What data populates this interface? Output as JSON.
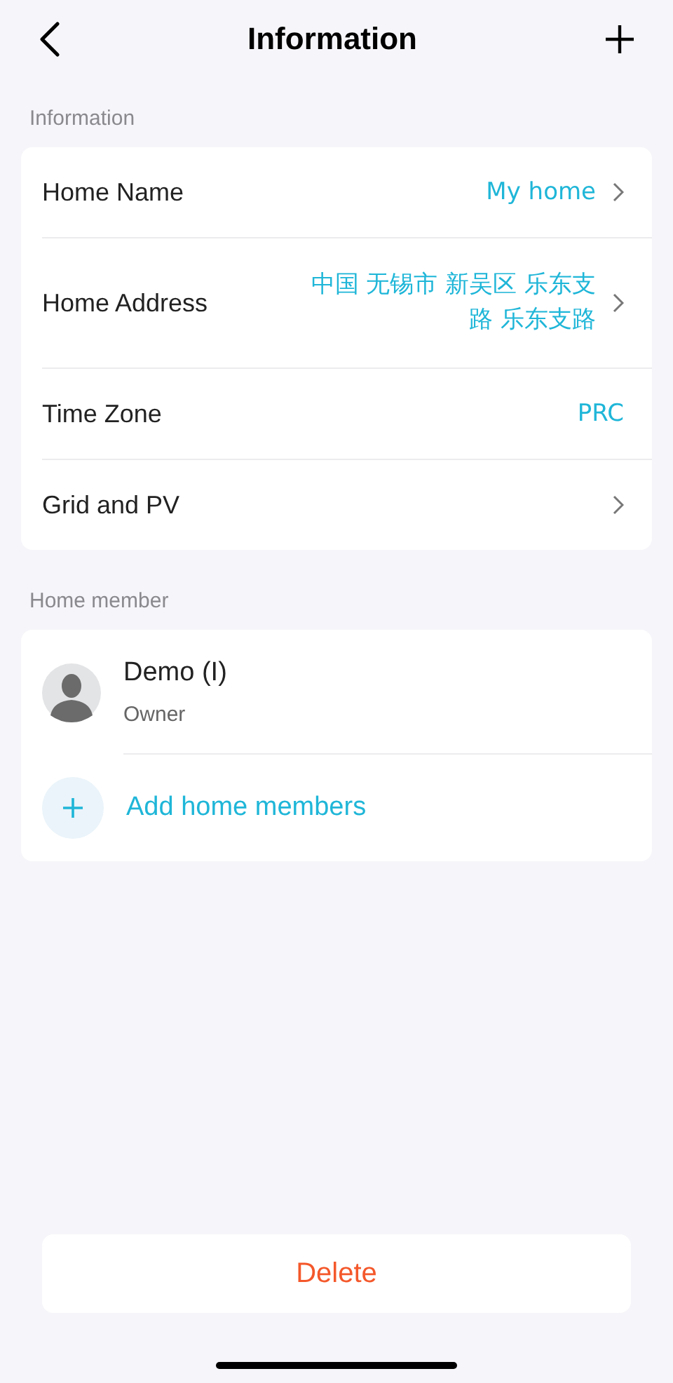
{
  "header": {
    "title": "Information"
  },
  "info_section": {
    "label": "Information",
    "rows": [
      {
        "label": "Home Name",
        "value": "My home",
        "chevron": true
      },
      {
        "label": "Home Address",
        "value": "中国 无锡市 新吴区 乐东支路 乐东支路",
        "chevron": true
      },
      {
        "label": "Time Zone",
        "value": "PRC",
        "chevron": false
      },
      {
        "label": "Grid and PV",
        "chevron": true
      }
    ]
  },
  "member_section": {
    "label": "Home member",
    "members": [
      {
        "name": "Demo (I)",
        "role": "Owner"
      }
    ],
    "add_label": "Add home members"
  },
  "delete_button": "Delete"
}
